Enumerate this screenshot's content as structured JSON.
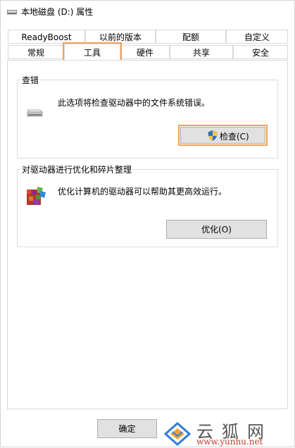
{
  "window": {
    "title": "本地磁盘 (D:) 属性"
  },
  "tabs": {
    "row1": [
      "ReadyBoost",
      "以前的版本",
      "配额",
      "自定义"
    ],
    "row2": [
      "常规",
      "工具",
      "硬件",
      "共享",
      "安全"
    ],
    "active": "工具"
  },
  "check_group": {
    "title": "查错",
    "description": "此选项将检查驱动器中的文件系统错误。",
    "button_label": "检查(C)"
  },
  "optimize_group": {
    "title": "对驱动器进行优化和碎片整理",
    "description": "优化计算机的驱动器可以帮助其更高效运行。",
    "button_label": "优化(O)"
  },
  "footer": {
    "ok_label": "确定"
  },
  "watermark": {
    "site": "www.yunhu.net",
    "brand": "云狐网"
  }
}
